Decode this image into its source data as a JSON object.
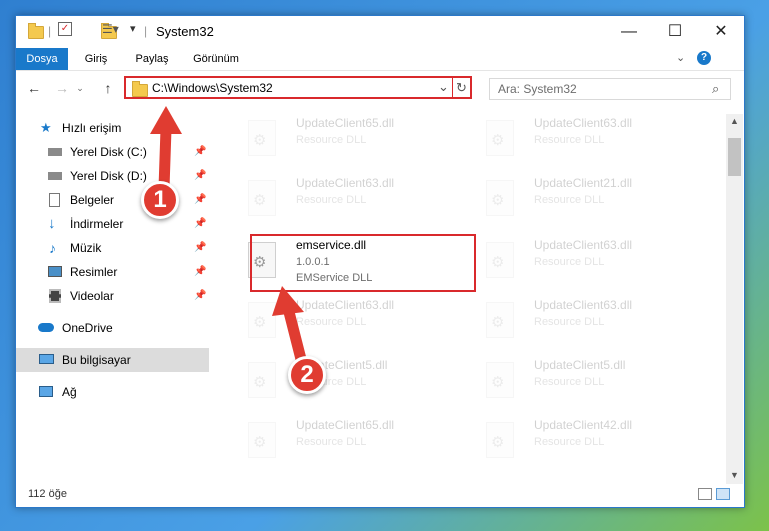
{
  "window": {
    "title": "System32",
    "controls": {
      "minimize": "—",
      "maximize": "☐",
      "close": "✕"
    }
  },
  "ribbon": {
    "tabs": [
      {
        "label": "Dosya",
        "active": true
      },
      {
        "label": "Giriş",
        "active": false
      },
      {
        "label": "Paylaş",
        "active": false
      },
      {
        "label": "Görünüm",
        "active": false
      }
    ],
    "expand_icon": "chevron-down-icon",
    "help_icon": "help-icon"
  },
  "address": {
    "path": "C:\\Windows\\System32",
    "search_placeholder": "Ara: System32"
  },
  "sidebar": {
    "items": [
      {
        "label": "Hızlı erişim",
        "icon": "star-icon",
        "pinned": false
      },
      {
        "label": "Yerel Disk (C:)",
        "icon": "drive-icon",
        "pinned": true
      },
      {
        "label": "Yerel Disk (D:)",
        "icon": "drive-icon",
        "pinned": true
      },
      {
        "label": "Belgeler",
        "icon": "document-icon",
        "pinned": true
      },
      {
        "label": "İndirmeler",
        "icon": "download-icon",
        "pinned": true
      },
      {
        "label": "Müzik",
        "icon": "music-icon",
        "pinned": true
      },
      {
        "label": "Resimler",
        "icon": "picture-icon",
        "pinned": true
      },
      {
        "label": "Videolar",
        "icon": "video-icon",
        "pinned": true
      },
      {
        "label": "OneDrive",
        "icon": "cloud-icon",
        "pinned": false
      },
      {
        "label": "Bu bilgisayar",
        "icon": "computer-icon",
        "pinned": false,
        "selected": true
      },
      {
        "label": "Ağ",
        "icon": "network-icon",
        "pinned": false
      }
    ]
  },
  "files": {
    "highlighted": {
      "name": "emservice.dll",
      "version": "1.0.0.1",
      "description": "EMService DLL"
    },
    "left_column": [
      {
        "name": "UpdateClient65.dll",
        "description": "Resource DLL"
      },
      {
        "name": "UpdateClient63.dll",
        "description": "Resource DLL"
      },
      {
        "name": "UpdateClient63.dll",
        "description": "Resource DLL"
      },
      {
        "name": "UpdateClient5.dll",
        "description": "Resource DLL"
      },
      {
        "name": "UpdateClient65.dll",
        "description": "Resource DLL"
      }
    ],
    "right_column": [
      {
        "name": "UpdateClient63.dll",
        "description": "Resource DLL"
      },
      {
        "name": "UpdateClient21.dll",
        "description": "Resource DLL"
      },
      {
        "name": "UpdateClient63.dll",
        "description": "Resource DLL"
      },
      {
        "name": "UpdateClient63.dll",
        "description": "Resource DLL"
      },
      {
        "name": "UpdateClient5.dll",
        "description": "Resource DLL"
      },
      {
        "name": "UpdateClient42.dll",
        "description": "Resource DLL"
      }
    ]
  },
  "status": {
    "count": "112 öğe"
  },
  "annotations": {
    "step1": "1",
    "step2": "2",
    "color": "#e03c31"
  }
}
